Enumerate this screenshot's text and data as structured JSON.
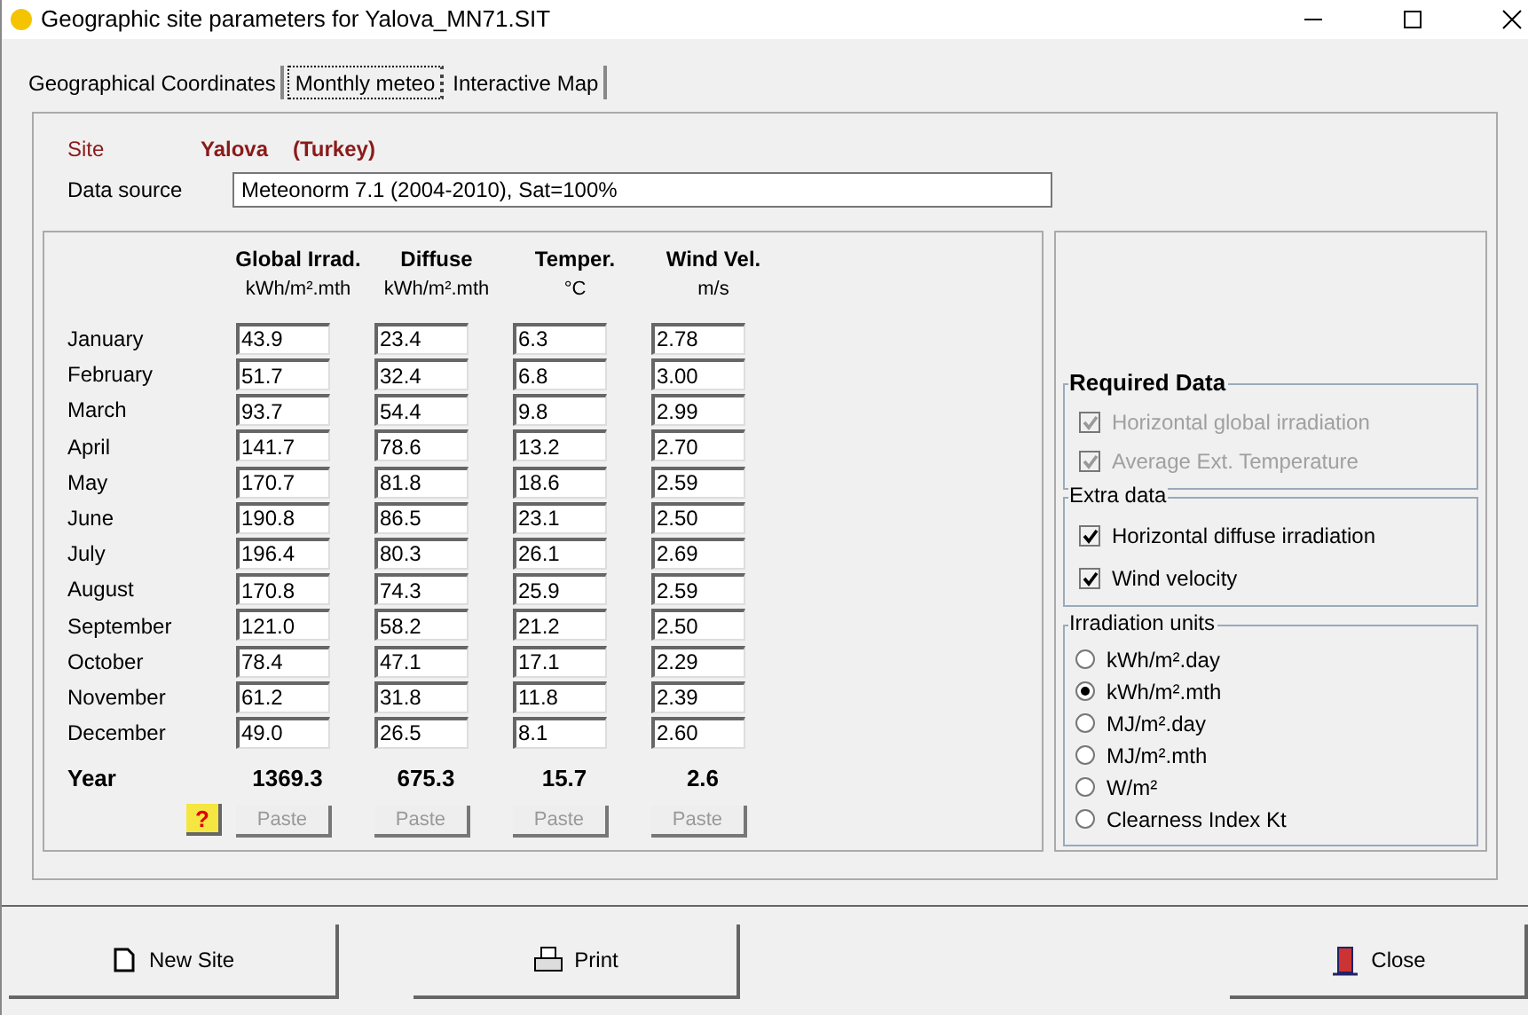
{
  "window": {
    "title": "Geographic site parameters for Yalova_MN71.SIT"
  },
  "tabs": [
    {
      "label": "Geographical Coordinates",
      "selected": false
    },
    {
      "label": "Monthly meteo",
      "selected": true
    },
    {
      "label": "Interactive Map",
      "selected": false
    }
  ],
  "site": {
    "label": "Site",
    "name": "Yalova",
    "country": "(Turkey)"
  },
  "data_source": {
    "label": "Data source",
    "value": "Meteonorm 7.1 (2004-2010), Sat=100%"
  },
  "table": {
    "columns": [
      {
        "title": "Global Irrad.",
        "unit": "kWh/m².mth"
      },
      {
        "title": "Diffuse",
        "unit": "kWh/m².mth"
      },
      {
        "title": "Temper.",
        "unit": "°C"
      },
      {
        "title": "Wind Vel.",
        "unit": "m/s"
      }
    ],
    "rows": [
      {
        "month": "January",
        "values": [
          "43.9",
          "23.4",
          "6.3",
          "2.78"
        ]
      },
      {
        "month": "February",
        "values": [
          "51.7",
          "32.4",
          "6.8",
          "3.00"
        ]
      },
      {
        "month": "March",
        "values": [
          "93.7",
          "54.4",
          "9.8",
          "2.99"
        ]
      },
      {
        "month": "April",
        "values": [
          "141.7",
          "78.6",
          "13.2",
          "2.70"
        ]
      },
      {
        "month": "May",
        "values": [
          "170.7",
          "81.8",
          "18.6",
          "2.59"
        ]
      },
      {
        "month": "June",
        "values": [
          "190.8",
          "86.5",
          "23.1",
          "2.50"
        ]
      },
      {
        "month": "July",
        "values": [
          "196.4",
          "80.3",
          "26.1",
          "2.69"
        ]
      },
      {
        "month": "August",
        "values": [
          "170.8",
          "74.3",
          "25.9",
          "2.59"
        ]
      },
      {
        "month": "September",
        "values": [
          "121.0",
          "58.2",
          "21.2",
          "2.50"
        ]
      },
      {
        "month": "October",
        "values": [
          "78.4",
          "47.1",
          "17.1",
          "2.29"
        ]
      },
      {
        "month": "November",
        "values": [
          "61.2",
          "31.8",
          "11.8",
          "2.39"
        ]
      },
      {
        "month": "December",
        "values": [
          "49.0",
          "26.5",
          "8.1",
          "2.60"
        ]
      }
    ],
    "year": {
      "label": "Year",
      "values": [
        "1369.3",
        "675.3",
        "15.7",
        "2.6"
      ]
    },
    "help_button": "?",
    "paste_buttons": [
      {
        "label": "Paste",
        "disabled": true
      },
      {
        "label": "Paste",
        "disabled": true
      },
      {
        "label": "Paste",
        "disabled": true
      },
      {
        "label": "Paste",
        "disabled": true
      }
    ]
  },
  "required_data": {
    "title": "Required Data",
    "items": [
      {
        "label": "Horizontal global irradiation",
        "checked": true,
        "disabled": true
      },
      {
        "label": "Average Ext. Temperature",
        "checked": true,
        "disabled": true
      }
    ]
  },
  "extra_data": {
    "title": "Extra data",
    "items": [
      {
        "label": "Horizontal diffuse irradiation",
        "checked": true,
        "disabled": false
      },
      {
        "label": "Wind velocity",
        "checked": true,
        "disabled": false
      }
    ]
  },
  "irradiation_units": {
    "title": "Irradiation units",
    "options": [
      {
        "label": "kWh/m².day",
        "selected": false
      },
      {
        "label": "kWh/m².mth",
        "selected": true
      },
      {
        "label": "MJ/m².day",
        "selected": false
      },
      {
        "label": "MJ/m².mth",
        "selected": false
      },
      {
        "label": "W/m²",
        "selected": false
      },
      {
        "label": "Clearness Index Kt",
        "selected": false
      }
    ]
  },
  "buttons": [
    {
      "label": "New Site",
      "kind": "new"
    },
    {
      "label": "Print",
      "kind": "print"
    },
    {
      "label": "Close",
      "kind": "close"
    }
  ]
}
